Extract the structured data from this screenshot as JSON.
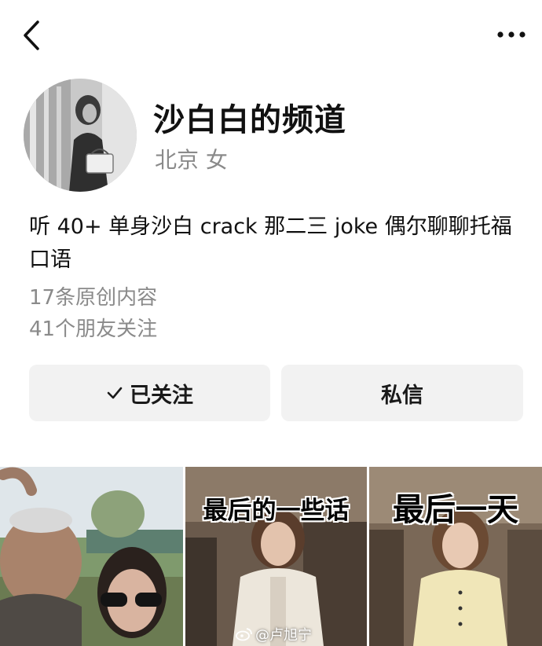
{
  "profile": {
    "name": "沙白白的频道",
    "location_gender": "北京 女",
    "bio": "听 40+ 单身沙白 crack 那二三 joke 偶尔聊聊托福口语",
    "original_content": "17条原创内容",
    "friends_following": "41个朋友关注"
  },
  "actions": {
    "follow_label": "已关注",
    "message_label": "私信"
  },
  "videos": [
    {
      "caption": ""
    },
    {
      "caption": "最后的一些话"
    },
    {
      "caption": "最后一天"
    }
  ],
  "watermark": "@卢旭宁",
  "icons": {
    "back": "chevron-left-icon",
    "more": "more-dots-icon",
    "follow_check": "check-icon",
    "watermark_logo": "weibo-icon"
  },
  "colors": {
    "button_bg": "#f2f2f2",
    "secondary_text": "#8a8a8a",
    "primary_text": "#111111"
  }
}
